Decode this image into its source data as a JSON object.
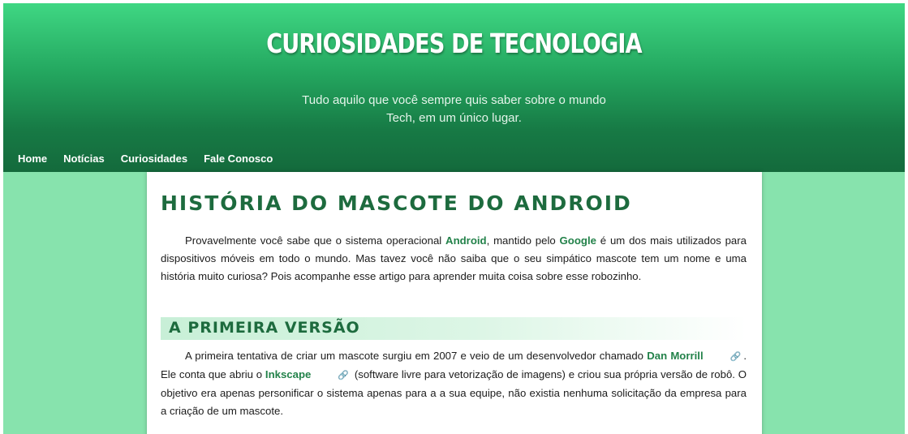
{
  "header": {
    "title": "CURIOSIDADES DE TECNOLOGIA",
    "subtitle_line1": "Tudo aquilo que você sempre quis saber sobre o mundo",
    "subtitle_line2": "Tech, em um único lugar."
  },
  "nav": {
    "items": [
      {
        "label": "Home"
      },
      {
        "label": "Notícias"
      },
      {
        "label": "Curiosidades"
      },
      {
        "label": "Fale Conosco"
      }
    ]
  },
  "article": {
    "title": "História do mascote do Android",
    "intro": {
      "p1": "Provavelmente você sabe que o sistema operacional ",
      "link_android": "Android",
      "p2": ", mantido pelo ",
      "link_google": "Google",
      "p3": " é um dos mais utilizados para dispositivos móveis em todo o mundo. Mas tavez você não saiba que o seu simpático mascote tem um nome e uma história muito curiosa? Pois acompanhe esse artigo para aprender muita coisa sobre esse robozinho."
    },
    "section": {
      "title": "A primeira versão",
      "p1": "A primeira tentativa de criar um mascote surgiu em 2007 e veio de um desenvolvedor chamado ",
      "link_dan": "Dan Morrill",
      "p2": ". Ele conta que abriu o ",
      "link_inkscape": "Inkscape",
      "p3": " (software livre para vetorização de imagens) e criou sua própria versão de robô. O objetivo era apenas personificar o sistema apenas para a a sua equipe, não existia nenhuma solicitação da empresa para a criação de um mascote."
    }
  },
  "colors": {
    "header_top": "#3fd783",
    "header_bottom": "#146a3c",
    "page_background": "#87e3ad",
    "accent": "#23824a",
    "title_green": "#1d6b3e"
  },
  "icons": {
    "external_link": "link-icon"
  }
}
